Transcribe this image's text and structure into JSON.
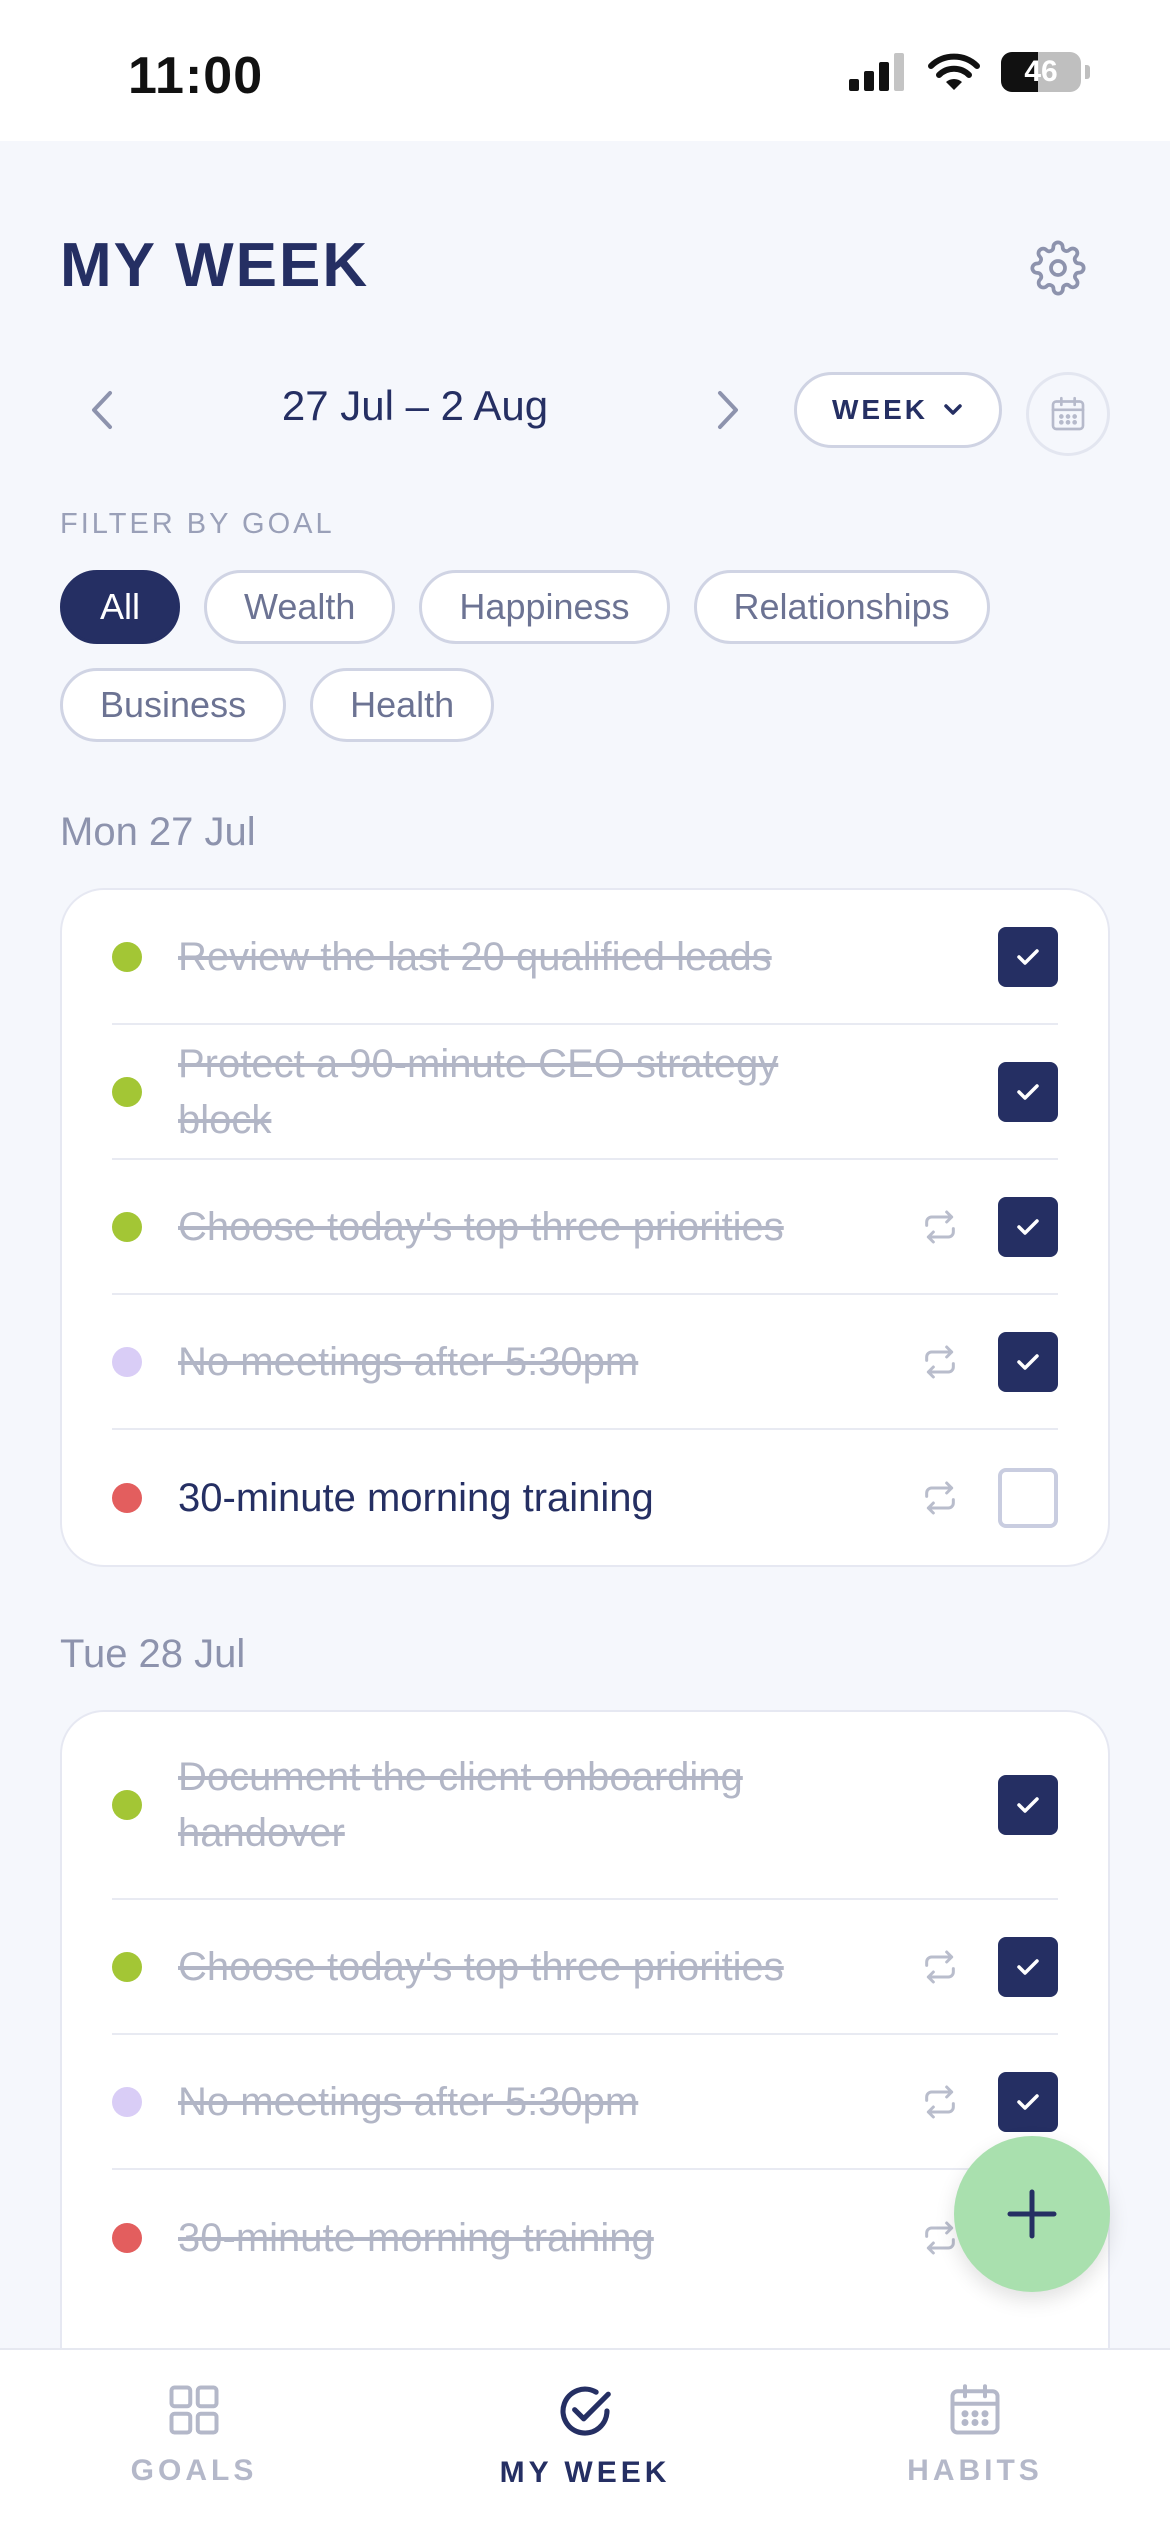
{
  "status": {
    "time": "11:00",
    "battery": "46"
  },
  "header": {
    "title": "MY WEEK"
  },
  "nav": {
    "range": "27 Jul – 2 Aug",
    "period": "WEEK"
  },
  "filter": {
    "label": "FILTER BY GOAL",
    "chips": [
      "All",
      "Wealth",
      "Happiness",
      "Relationships",
      "Business",
      "Health"
    ],
    "active": "All"
  },
  "colors": {
    "accent": "#252f63",
    "business": "#a3c635",
    "relationships": "#d9cdf6",
    "health": "#e35e5e",
    "fab": "#a9e0ae"
  },
  "days": [
    {
      "label": "Mon 27 Jul",
      "tasks": [
        {
          "text": "Review the last 20 qualified leads",
          "goal": "business",
          "done": true,
          "repeat": false
        },
        {
          "text": "Protect a 90-minute CEO strategy block",
          "goal": "business",
          "done": true,
          "repeat": false
        },
        {
          "text": "Choose today's top three priorities",
          "goal": "business",
          "done": true,
          "repeat": true
        },
        {
          "text": "No meetings after 5:30pm",
          "goal": "relationships",
          "done": true,
          "repeat": true
        },
        {
          "text": "30-minute morning training",
          "goal": "health",
          "done": false,
          "repeat": true
        }
      ]
    },
    {
      "label": "Tue 28 Jul",
      "tasks": [
        {
          "text": "Document the client onboarding handover",
          "goal": "business",
          "done": true,
          "repeat": false
        },
        {
          "text": "Choose today's top three priorities",
          "goal": "business",
          "done": true,
          "repeat": true
        },
        {
          "text": "No meetings after 5:30pm",
          "goal": "relationships",
          "done": true,
          "repeat": true
        },
        {
          "text": "30-minute morning training",
          "goal": "health",
          "done": true,
          "repeat": true
        }
      ]
    }
  ],
  "tabs": [
    {
      "label": "GOALS",
      "icon": "grid-icon"
    },
    {
      "label": "MY WEEK",
      "icon": "check-circle-icon",
      "active": true
    },
    {
      "label": "HABITS",
      "icon": "calendar-icon"
    }
  ]
}
